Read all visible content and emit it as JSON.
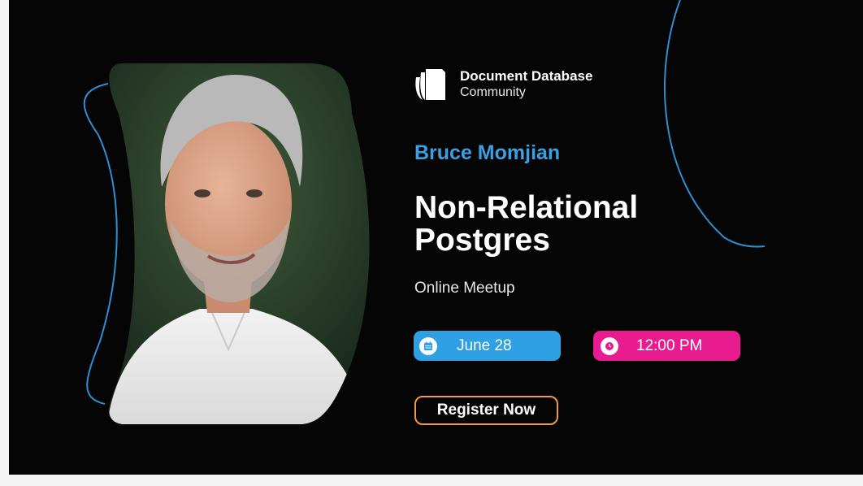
{
  "brand": {
    "name": "Document Database",
    "sub": "Community"
  },
  "speaker": "Bruce Momjian",
  "title_line1": "Non-Relational",
  "title_line2": "Postgres",
  "subtitle": "Online Meetup",
  "date": "June 28",
  "time": "12:00 PM",
  "cta": "Register Now",
  "colors": {
    "background": "#050505",
    "accent_blue": "#2fa0e4",
    "accent_pink": "#e81c8f",
    "cta_border": "#f29a3d",
    "speaker_name": "#3aa0e2"
  },
  "icons": {
    "logo": "stacked-documents-icon",
    "date": "calendar-icon",
    "time": "clock-icon"
  }
}
